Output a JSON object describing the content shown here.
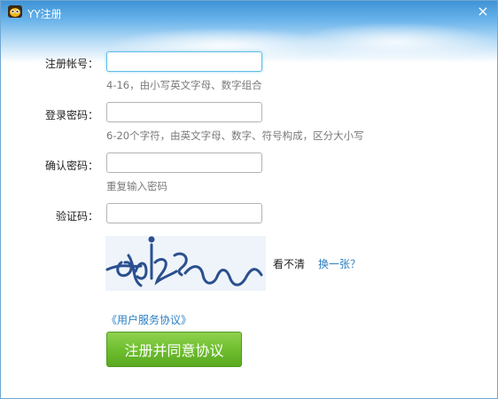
{
  "window": {
    "title": "YY注册",
    "close_glyph": "×"
  },
  "form": {
    "account": {
      "label": "注册帐号：",
      "value": "",
      "hint": "4-16，由小写英文字母、数字组合"
    },
    "password": {
      "label": "登录密码：",
      "value": "",
      "hint": "6-20个字符，由英文字母、数字、符号构成，区分大小写"
    },
    "confirm": {
      "label": "确认密码：",
      "value": "",
      "hint": "重复输入密码"
    },
    "captcha": {
      "label": "验证码：",
      "value": ""
    }
  },
  "captcha_actions": {
    "unclear": "看不清",
    "refresh": "换一张？"
  },
  "agreement_link": "《用户服务协议》",
  "submit_label": "注册并同意协议",
  "colors": {
    "accent_link": "#2c7fc2",
    "submit_green": "#6fbf2f",
    "title_blue": "#3f93d6"
  },
  "icons": [
    "yy-logo-icon",
    "close-icon"
  ]
}
